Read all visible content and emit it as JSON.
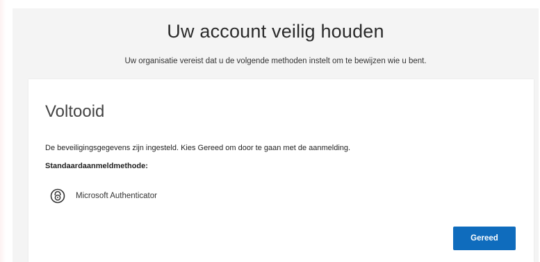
{
  "header": {
    "title": "Uw account veilig houden",
    "subtitle": "Uw organisatie vereist dat u de volgende methoden instelt om te bewijzen wie u bent."
  },
  "card": {
    "title": "Voltooid",
    "description": "De beveiligingsgegevens zijn ingesteld. Kies Gereed om door te gaan met de aanmelding.",
    "default_method_label": "Standaardaanmeldmethode:",
    "method": {
      "icon": "authenticator-lock-icon",
      "name": "Microsoft Authenticator"
    },
    "done_label": "Gereed"
  },
  "colors": {
    "accent": "#0f6cbd",
    "background": "#f4f4f4",
    "card": "#ffffff"
  }
}
